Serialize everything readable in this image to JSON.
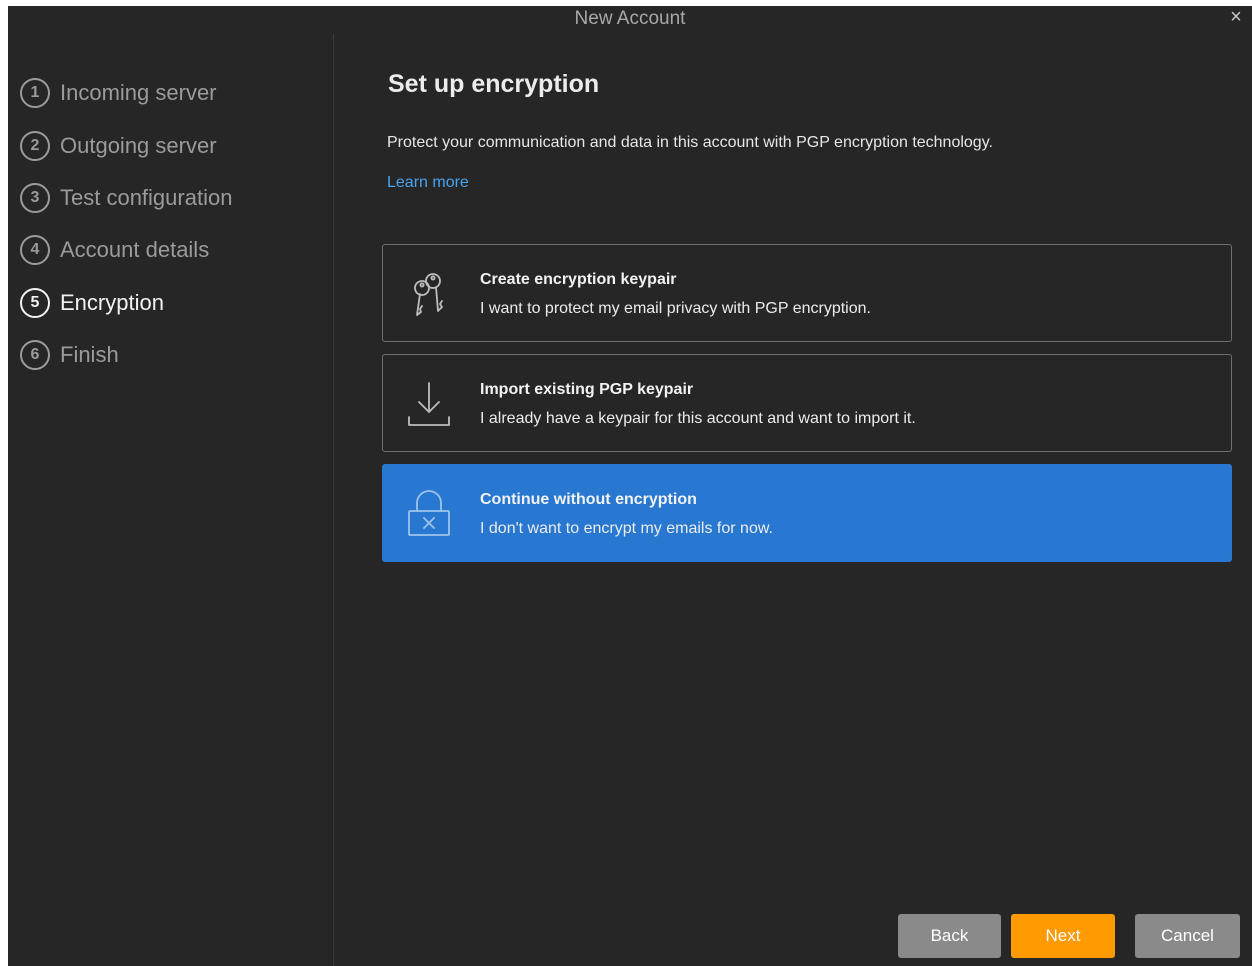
{
  "window": {
    "title": "New Account",
    "close_icon": "close-icon"
  },
  "steps": [
    {
      "num": "1",
      "label": "Incoming server",
      "active": false
    },
    {
      "num": "2",
      "label": "Outgoing server",
      "active": false
    },
    {
      "num": "3",
      "label": "Test configuration",
      "active": false
    },
    {
      "num": "4",
      "label": "Account details",
      "active": false
    },
    {
      "num": "5",
      "label": "Encryption",
      "active": true
    },
    {
      "num": "6",
      "label": "Finish",
      "active": false
    }
  ],
  "main": {
    "title": "Set up encryption",
    "description": "Protect your communication and data in this account with PGP encryption technology.",
    "learn_more": "Learn more",
    "options": [
      {
        "icon": "keys-icon",
        "title": "Create encryption keypair",
        "subtitle": "I want to protect my email privacy with PGP encryption.",
        "selected": false
      },
      {
        "icon": "import-download-icon",
        "title": "Import existing PGP keypair",
        "subtitle": "I already have a keypair for this account and want to import it.",
        "selected": false
      },
      {
        "icon": "unlocked-padlock-icon",
        "title": "Continue without encryption",
        "subtitle": "I don't want to encrypt my emails for now.",
        "selected": true
      }
    ]
  },
  "buttons": {
    "back": "Back",
    "next": "Next",
    "cancel": "Cancel"
  },
  "colors": {
    "background": "#262626",
    "accent": "#2877d0",
    "primary_button": "#ff9a00",
    "link": "#4aa3ee"
  }
}
